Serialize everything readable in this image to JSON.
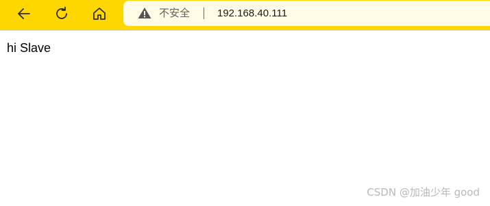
{
  "toolbar": {
    "back_icon": "back-arrow-icon",
    "reload_icon": "reload-icon",
    "home_icon": "home-icon",
    "accent_color": "#ffd700"
  },
  "address_bar": {
    "security_icon": "warning-icon",
    "security_label": "不安全",
    "url": "192.168.40.111"
  },
  "page": {
    "body_text": "hi Slave"
  },
  "watermark": {
    "text": "CSDN @加油少年 good"
  }
}
